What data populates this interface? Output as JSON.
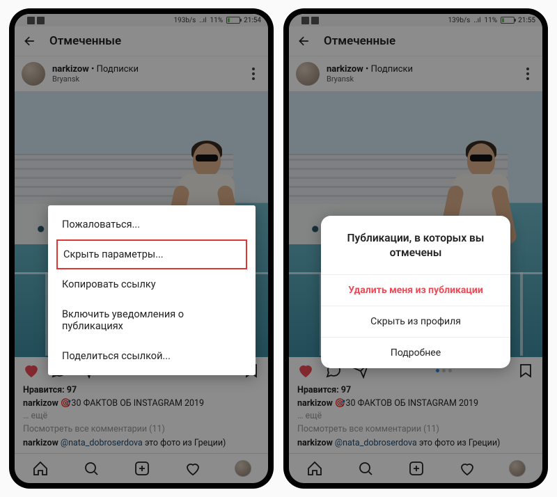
{
  "status": {
    "speed_left": "193b/s",
    "speed_right": "139b/s",
    "signal": "..ıl",
    "pct": "11%",
    "time": "21:54",
    "time_r": "21:55"
  },
  "header": {
    "title": "Отмеченные"
  },
  "post": {
    "username": "narkizow",
    "follow": "Подписки",
    "sep": " • ",
    "location": "Bryansk"
  },
  "actions": {
    "likes_label": "Нравится: ",
    "likes_count": "97"
  },
  "caption": {
    "user": "narkizow",
    "text": " 🎯30 ФАКТОВ ОБ INSTAGRAM 2019",
    "more": "… ещё",
    "viewall": "Посмотреть все комментарии (11)",
    "c_user": "narkizow",
    "c_mention": "@nata_dobroserdova",
    "c_tail": " это фото из Греции)"
  },
  "menu": {
    "i1": "Пожаловаться...",
    "i2": "Скрыть параметры...",
    "i3": "Копировать ссылку",
    "i4": "Включить уведомления о публикациях",
    "i5": "Поделиться ссылкой..."
  },
  "dialog": {
    "title": "Публикации, в которых вы отмечены",
    "b1": "Удалить меня из публикации",
    "b2": "Скрыть из профиля",
    "b3": "Подробнее"
  }
}
